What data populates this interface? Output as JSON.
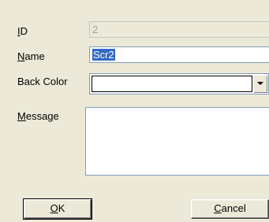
{
  "form": {
    "id": {
      "label_accel": "I",
      "label_rest": "D",
      "value": "2"
    },
    "name": {
      "label_accel": "N",
      "label_rest": "ame",
      "value": "Scr2"
    },
    "back_color": {
      "label": "Back Color",
      "value": ""
    },
    "message": {
      "label_accel": "M",
      "label_rest": "essage",
      "value": ""
    }
  },
  "buttons": {
    "ok": {
      "label_accel": "O",
      "label_rest": "K"
    },
    "cancel": {
      "label_accel": "C",
      "label_rest": "ancel"
    }
  }
}
